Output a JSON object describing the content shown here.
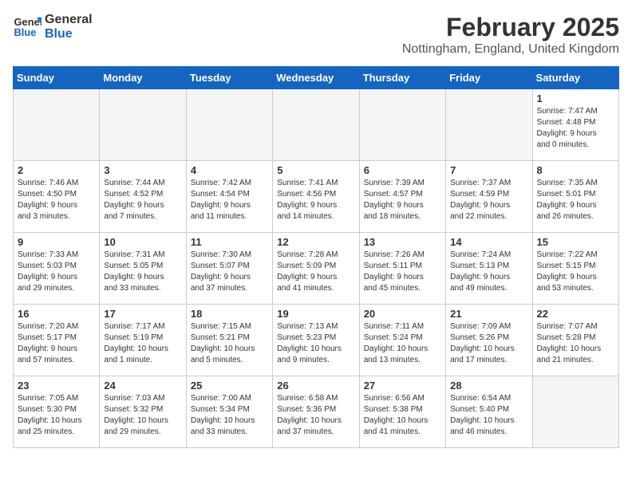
{
  "header": {
    "logo_general": "General",
    "logo_blue": "Blue",
    "month_year": "February 2025",
    "location": "Nottingham, England, United Kingdom"
  },
  "days_of_week": [
    "Sunday",
    "Monday",
    "Tuesday",
    "Wednesday",
    "Thursday",
    "Friday",
    "Saturday"
  ],
  "weeks": [
    [
      {
        "day": "",
        "info": ""
      },
      {
        "day": "",
        "info": ""
      },
      {
        "day": "",
        "info": ""
      },
      {
        "day": "",
        "info": ""
      },
      {
        "day": "",
        "info": ""
      },
      {
        "day": "",
        "info": ""
      },
      {
        "day": "1",
        "info": "Sunrise: 7:47 AM\nSunset: 4:48 PM\nDaylight: 9 hours\nand 0 minutes."
      }
    ],
    [
      {
        "day": "2",
        "info": "Sunrise: 7:46 AM\nSunset: 4:50 PM\nDaylight: 9 hours\nand 3 minutes."
      },
      {
        "day": "3",
        "info": "Sunrise: 7:44 AM\nSunset: 4:52 PM\nDaylight: 9 hours\nand 7 minutes."
      },
      {
        "day": "4",
        "info": "Sunrise: 7:42 AM\nSunset: 4:54 PM\nDaylight: 9 hours\nand 11 minutes."
      },
      {
        "day": "5",
        "info": "Sunrise: 7:41 AM\nSunset: 4:56 PM\nDaylight: 9 hours\nand 14 minutes."
      },
      {
        "day": "6",
        "info": "Sunrise: 7:39 AM\nSunset: 4:57 PM\nDaylight: 9 hours\nand 18 minutes."
      },
      {
        "day": "7",
        "info": "Sunrise: 7:37 AM\nSunset: 4:59 PM\nDaylight: 9 hours\nand 22 minutes."
      },
      {
        "day": "8",
        "info": "Sunrise: 7:35 AM\nSunset: 5:01 PM\nDaylight: 9 hours\nand 26 minutes."
      }
    ],
    [
      {
        "day": "9",
        "info": "Sunrise: 7:33 AM\nSunset: 5:03 PM\nDaylight: 9 hours\nand 29 minutes."
      },
      {
        "day": "10",
        "info": "Sunrise: 7:31 AM\nSunset: 5:05 PM\nDaylight: 9 hours\nand 33 minutes."
      },
      {
        "day": "11",
        "info": "Sunrise: 7:30 AM\nSunset: 5:07 PM\nDaylight: 9 hours\nand 37 minutes."
      },
      {
        "day": "12",
        "info": "Sunrise: 7:28 AM\nSunset: 5:09 PM\nDaylight: 9 hours\nand 41 minutes."
      },
      {
        "day": "13",
        "info": "Sunrise: 7:26 AM\nSunset: 5:11 PM\nDaylight: 9 hours\nand 45 minutes."
      },
      {
        "day": "14",
        "info": "Sunrise: 7:24 AM\nSunset: 5:13 PM\nDaylight: 9 hours\nand 49 minutes."
      },
      {
        "day": "15",
        "info": "Sunrise: 7:22 AM\nSunset: 5:15 PM\nDaylight: 9 hours\nand 53 minutes."
      }
    ],
    [
      {
        "day": "16",
        "info": "Sunrise: 7:20 AM\nSunset: 5:17 PM\nDaylight: 9 hours\nand 57 minutes."
      },
      {
        "day": "17",
        "info": "Sunrise: 7:17 AM\nSunset: 5:19 PM\nDaylight: 10 hours\nand 1 minute."
      },
      {
        "day": "18",
        "info": "Sunrise: 7:15 AM\nSunset: 5:21 PM\nDaylight: 10 hours\nand 5 minutes."
      },
      {
        "day": "19",
        "info": "Sunrise: 7:13 AM\nSunset: 5:23 PM\nDaylight: 10 hours\nand 9 minutes."
      },
      {
        "day": "20",
        "info": "Sunrise: 7:11 AM\nSunset: 5:24 PM\nDaylight: 10 hours\nand 13 minutes."
      },
      {
        "day": "21",
        "info": "Sunrise: 7:09 AM\nSunset: 5:26 PM\nDaylight: 10 hours\nand 17 minutes."
      },
      {
        "day": "22",
        "info": "Sunrise: 7:07 AM\nSunset: 5:28 PM\nDaylight: 10 hours\nand 21 minutes."
      }
    ],
    [
      {
        "day": "23",
        "info": "Sunrise: 7:05 AM\nSunset: 5:30 PM\nDaylight: 10 hours\nand 25 minutes."
      },
      {
        "day": "24",
        "info": "Sunrise: 7:03 AM\nSunset: 5:32 PM\nDaylight: 10 hours\nand 29 minutes."
      },
      {
        "day": "25",
        "info": "Sunrise: 7:00 AM\nSunset: 5:34 PM\nDaylight: 10 hours\nand 33 minutes."
      },
      {
        "day": "26",
        "info": "Sunrise: 6:58 AM\nSunset: 5:36 PM\nDaylight: 10 hours\nand 37 minutes."
      },
      {
        "day": "27",
        "info": "Sunrise: 6:56 AM\nSunset: 5:38 PM\nDaylight: 10 hours\nand 41 minutes."
      },
      {
        "day": "28",
        "info": "Sunrise: 6:54 AM\nSunset: 5:40 PM\nDaylight: 10 hours\nand 46 minutes."
      },
      {
        "day": "",
        "info": ""
      }
    ]
  ]
}
